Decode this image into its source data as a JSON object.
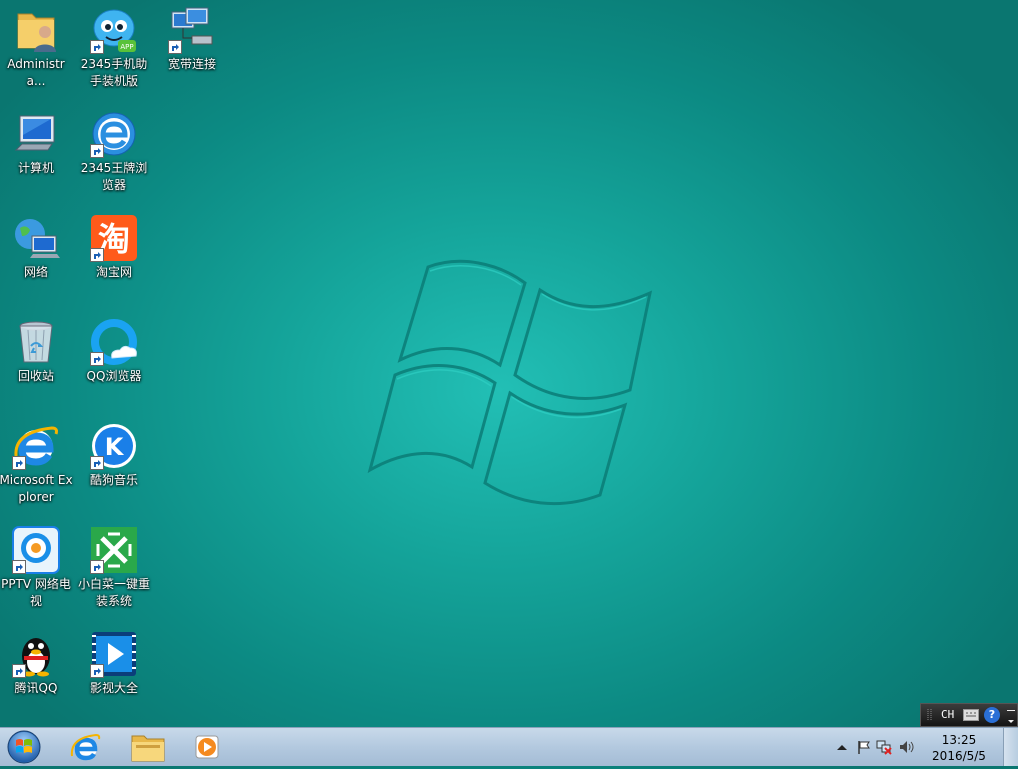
{
  "desktop": {
    "icons": [
      {
        "label": "Administra..."
      },
      {
        "label": "2345手机助手装机版"
      },
      {
        "label": "宽带连接"
      },
      {
        "label": "计算机"
      },
      {
        "label": "2345王牌浏览器"
      },
      {
        "label": "网络"
      },
      {
        "label": "淘宝网"
      },
      {
        "label": "回收站"
      },
      {
        "label": "QQ浏览器"
      },
      {
        "label": "Microsoft Explorer"
      },
      {
        "label": "酷狗音乐"
      },
      {
        "label": "PPTV 网络电视"
      },
      {
        "label": "小白菜一键重装系统"
      },
      {
        "label": "腾讯QQ"
      },
      {
        "label": "影视大全"
      }
    ],
    "taobao_glyph": "淘",
    "app_badge": "APP",
    "kugou_glyph": "K"
  },
  "language_bar": {
    "lang": "CH",
    "help": "?"
  },
  "taskbar": {
    "pinned": [
      {
        "name": "internet-explorer"
      },
      {
        "name": "windows-explorer"
      },
      {
        "name": "media-player"
      }
    ]
  },
  "tray": {
    "time": "13:25",
    "date": "2016/5/5"
  },
  "colors": {
    "wallpaper": "#15a59b",
    "taskbar": "#b3c9df"
  }
}
